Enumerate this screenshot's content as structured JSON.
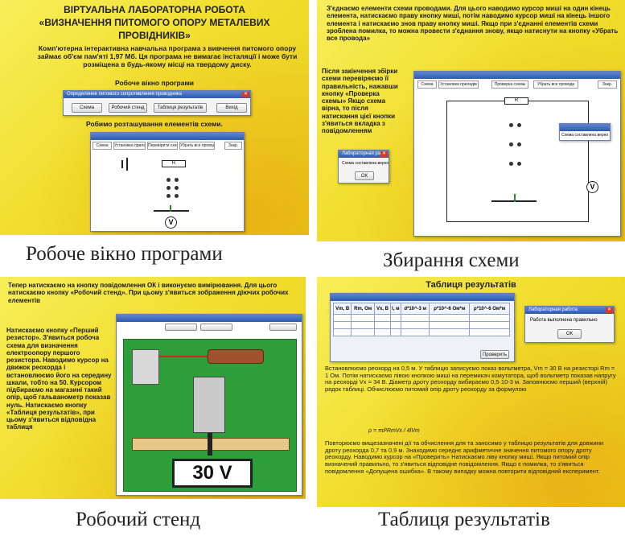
{
  "slide1": {
    "title_line1": "ВІРТУАЛЬНА ЛАБОРАТОРНА РОБОТА",
    "title_line2": "«ВИЗНАЧЕННЯ ПИТОМОГО ОПОРУ МЕТАЛЕВИХ",
    "title_line3": "ПРОВІДНИКІВ»",
    "intro": "Комп'ютерна інтерактивна навчальна програма з вивчення питомого опору займає об'єм пам'яті 1,97 Мб. Ця програма не вимагає інсталяції і може бути розміщена в будь-якому місці на твердому диску.",
    "window_label": "Робоче  вікно програми",
    "main_window": {
      "title": "Определение питомого сопротивления проводника",
      "buttons": [
        "Схема",
        "Робочий стенд",
        "Таблиця результатів",
        "Вихід"
      ]
    },
    "placement_label": "Робимо розташування елементів схеми.",
    "scheme_window": {
      "tabs": [
        "Схема",
        "Установка приладів",
        "Перевірити схему",
        "Убрать все провода",
        "Закр."
      ],
      "resistor_label": "R",
      "voltmeter_label": "V"
    }
  },
  "caption1": "Робоче вікно програми",
  "slide2": {
    "text": "З'єднаємо елементи схеми проводами. Для цього наводимо курсор миші на один кінець елемента,  натискаємо праву кнопку миші, потім наводимо курсор миші на кінець іншого елемента і натискаємо знов праву кнопку миші. Якщо при з'єднанні елементів схеми зроблена помилка, то можна провести з'єднання знову, якщо натиснути на кнопку «Убрать все провода»",
    "side_text": "Після закінчення збірки схеми перевіряємо її правильність, нажавши кнопку «Проверка схемы» Якщо схема вірна, то після натискання цієї кнопки з'явиться вкладка з повідомленням",
    "scheme_window": {
      "tabs": [
        "Схема",
        "Установка приладів",
        "Проверка схемы",
        "Убрать все провода",
        "Закр."
      ],
      "resistor_label": "R",
      "voltmeter_label": "V",
      "inline_message": "Схема составлена верно"
    },
    "dialog": {
      "title": "Лабораторная ра",
      "message": "Схема составлена верно",
      "ok": "ОК"
    }
  },
  "caption2": "Збирання схеми",
  "slide3": {
    "text": "Тепер натискаємо на кнопку повідомлення ОК і виконуємо вимірювання. Для цього натискаємо кнопку «Робочий стенд». При цьому з'явиться зображення діючих робочих елементів",
    "side_text": "Натискаємо кнопку «Перший резистор». З'явиться робоча схема для визначення електроопору першого резистора. Наводимо курсор на движок реохорда і встановлюємо його на середину шкали, тобто на 50. Курсором підбираємо на магазині такий опір, щоб гальванометр показав нуль. Натискаємо кнопку «Таблиця результатів», при цьому з'явиться відповідна таблиця",
    "display": "30 V"
  },
  "caption3": "Робочий стенд",
  "slide4": {
    "title": "Таблиця результатів",
    "table_headers": [
      "Vm, В",
      "Rm, Ом",
      "Vx, В",
      "l, м",
      "d*10^-3 м",
      "ρ*10^-6 Ом*м",
      "ρ*10^-6 Ом*м"
    ],
    "check_button": "Проверить",
    "dialog": {
      "title": "Лабораторная работа",
      "message": "Работа выполнена правильно",
      "ok": "ОК"
    },
    "text1": "Встановлюємо реохорд на 0,5 м. У таблицю записуємо показ вольтметра, Vm = 30 В на резисторі Rm = 1 Ом. Потім натискаємо лівою кнопкою миші на перемикач комутатора, щоб вольтметр показав напругу на реохорді Vx = 34 В. Діаметр дроту реохорду вибираємо 0,5·10-3 м. Заповнюємо перший (верхній) рядок таблиці. Обчислюємо питомий опір дроту реохорду  за формулою",
    "formula": "ρ = πd²RmVx / 4lVm",
    "text2": "Повторюємо вищезазначені дії та обчислення для та заносимо у таблицю результатів для довжини дроту реохорда 0,7 та 0,9 м. Знаходимо середнє арифметичне значення питомого опору дроту реохорду. Наводимо курсор на «Проверить» Натискаємо ліву кнопку миші. Якщо питомий опір визначений правильно, то з'явиться відповідне повідомлення. Якщо є помилка, то з'явиться повідомлення «Допущена ошибка». В такому випадку можна повторити відповідний експеримент."
  },
  "caption4": "Таблиця результатів"
}
